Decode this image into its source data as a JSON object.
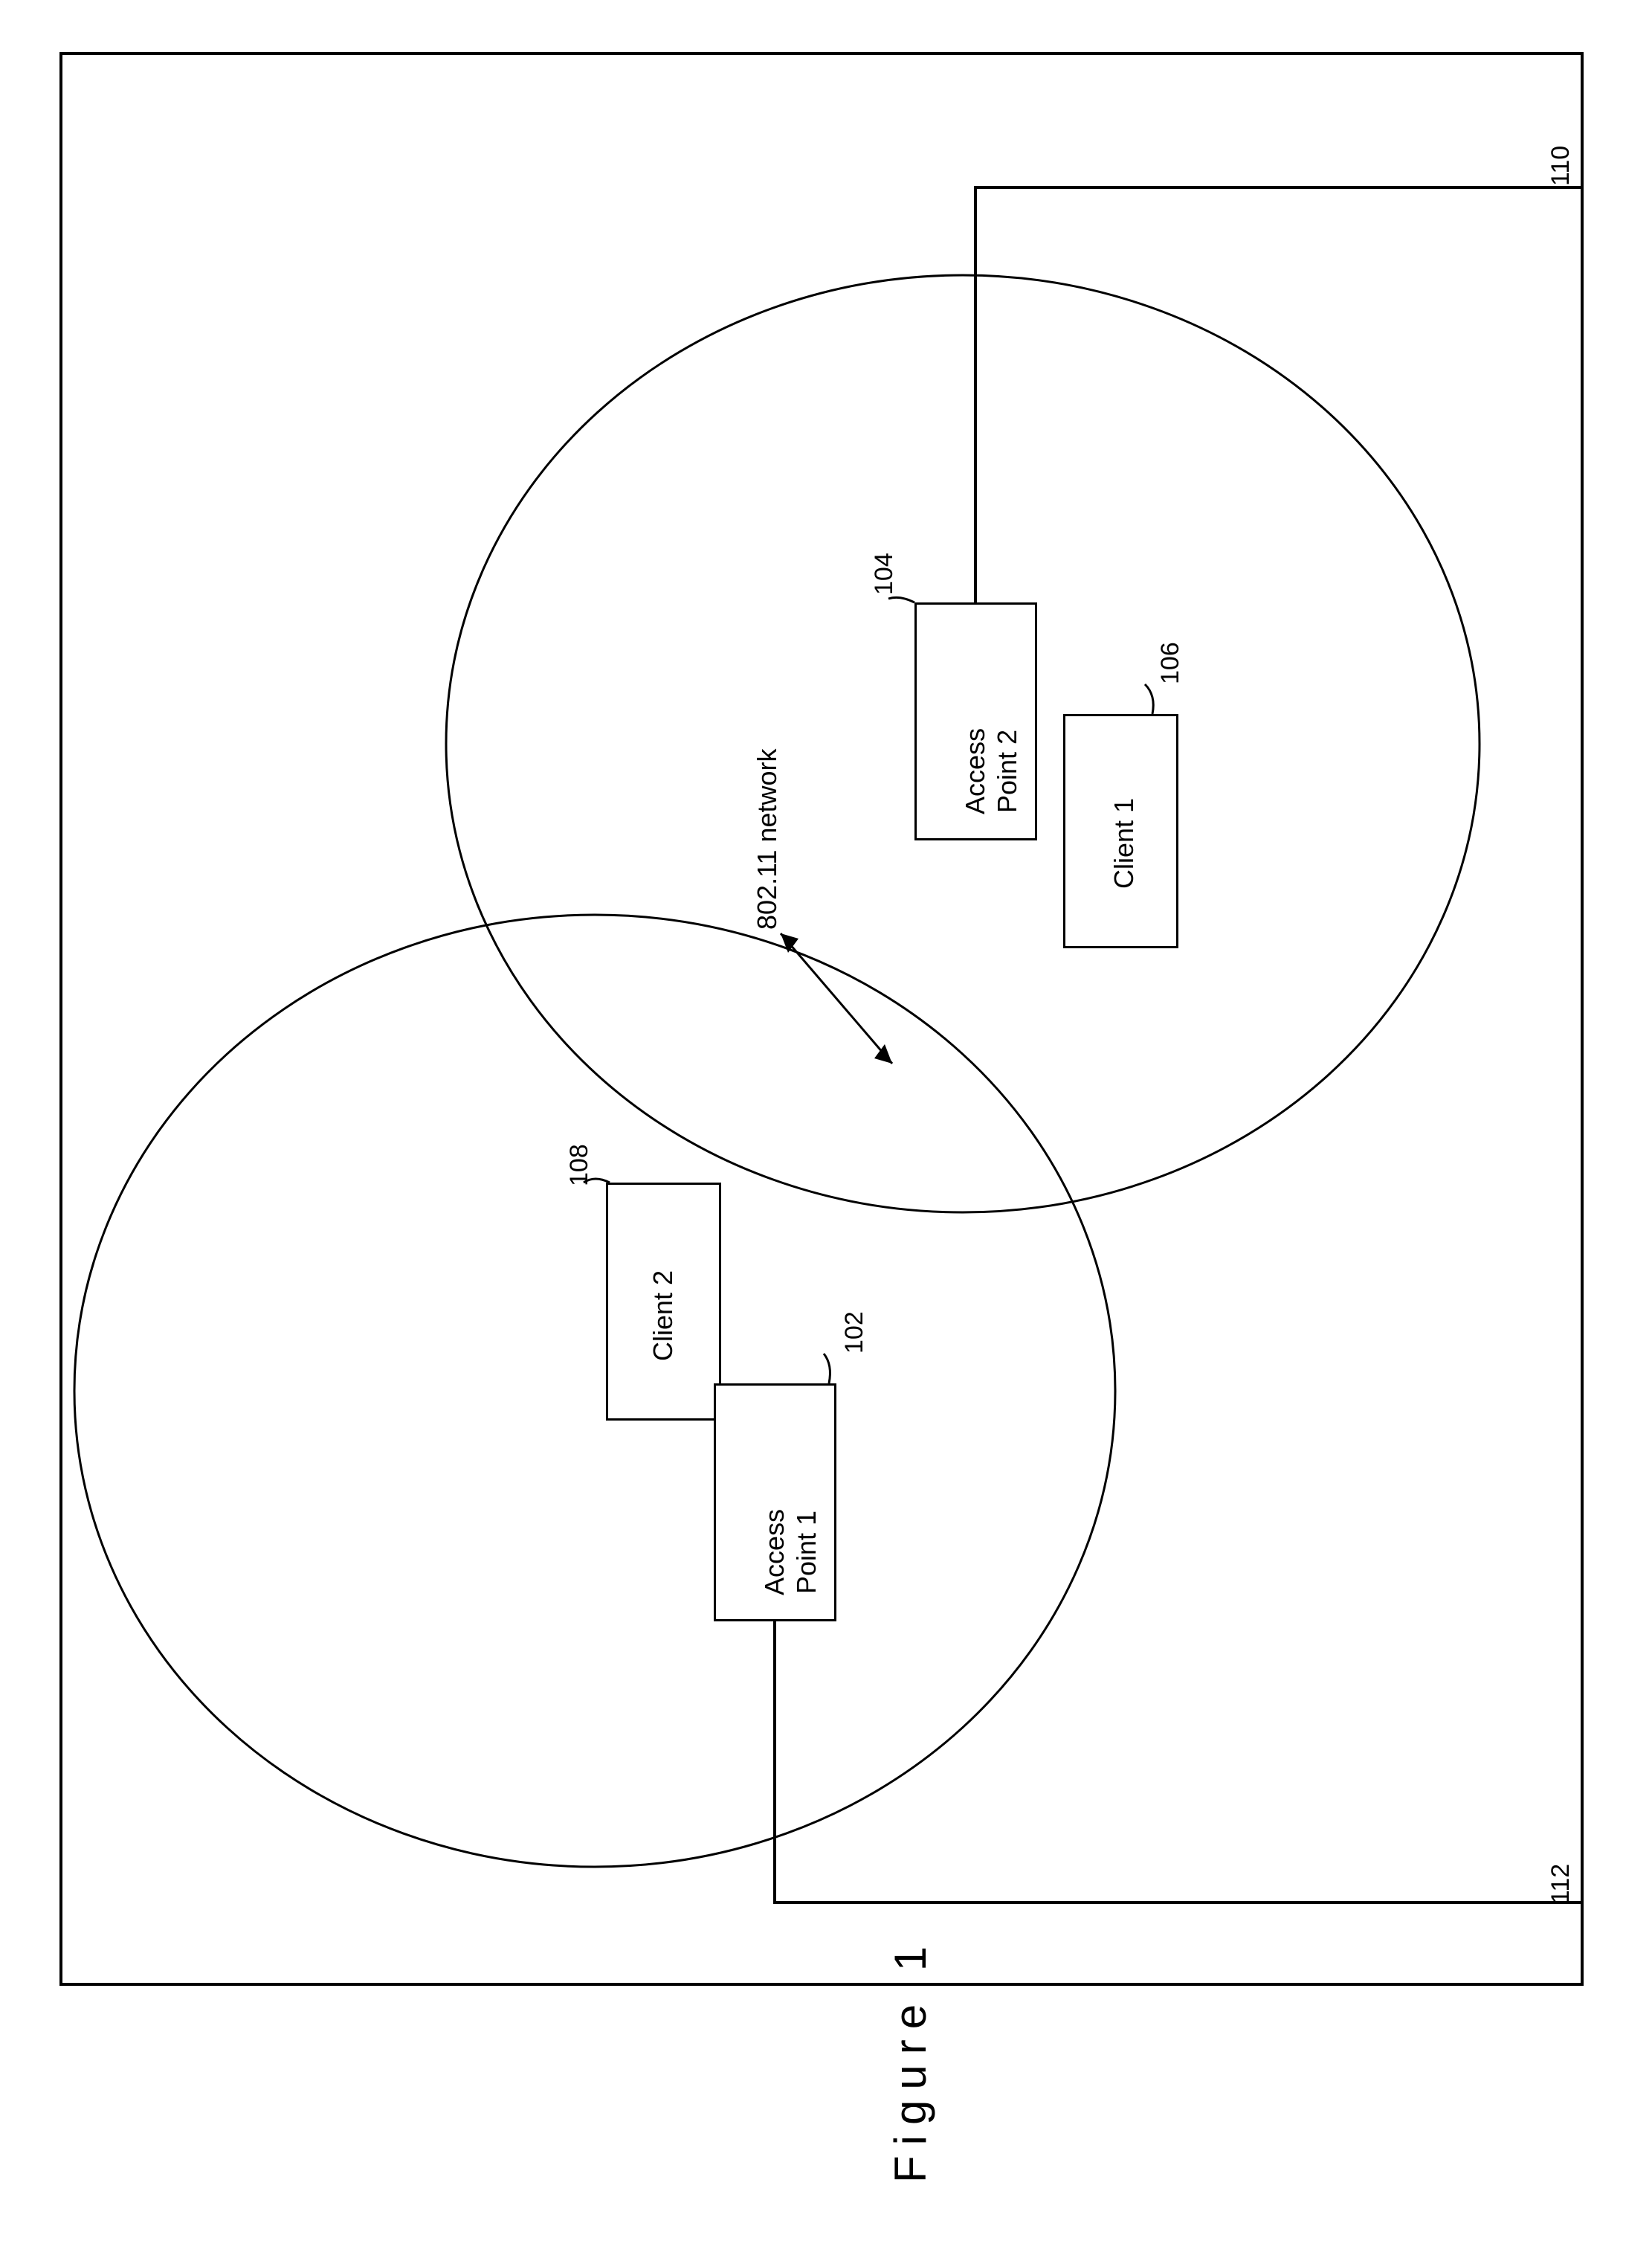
{
  "figure_label": "Figure 1",
  "network_label": "802.11 network",
  "nodes": {
    "ap1": {
      "label": "Access\nPoint 1",
      "ref": "102"
    },
    "ap2": {
      "label": "Access\nPoint 2",
      "ref": "104"
    },
    "client1": {
      "label": "Client 1",
      "ref": "106"
    },
    "client2": {
      "label": "Client 2",
      "ref": "108"
    }
  },
  "wires": {
    "top_exit": {
      "ref": "110"
    },
    "bottom_exit": {
      "ref": "112"
    }
  }
}
